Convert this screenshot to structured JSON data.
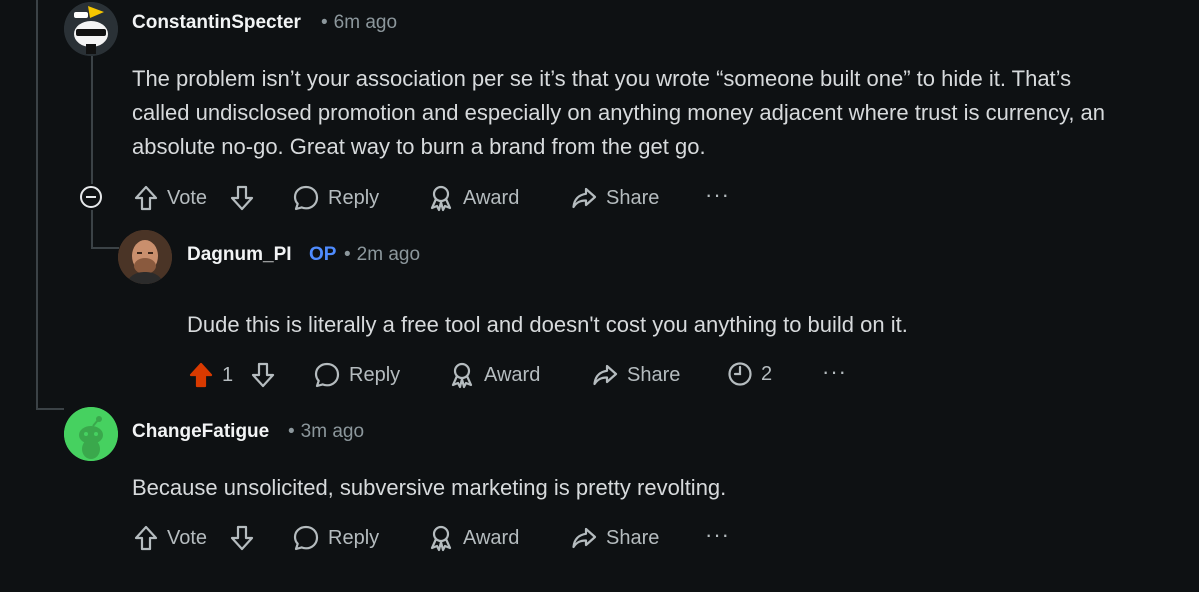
{
  "comments": [
    {
      "author": "ConstantinSpecter",
      "time": "6m ago",
      "text_lines": [
        "The problem isn’t your association per se it’s that you wrote “someone built one” to hide it. That’s",
        "called undisclosed promotion and especially on anything money adjacent where trust is currency, an",
        "absolute no-go. Great way to burn a brand from the get go."
      ],
      "actions": {
        "vote": "Vote",
        "reply": "Reply",
        "award": "Award",
        "share": "Share"
      }
    },
    {
      "author": "Dagnum_PI",
      "op_badge": "OP",
      "time": "2m ago",
      "text": "Dude this is literally a free tool and doesn't cost you anything to build on it.",
      "actions": {
        "votes": "1",
        "reply": "Reply",
        "award": "Award",
        "share": "Share",
        "awards_count": "2"
      },
      "upvoted_color": "#d93a00"
    },
    {
      "author": "ChangeFatigue",
      "time": "3m ago",
      "text": "Because unsolicited, subversive marketing is pretty revolting.",
      "actions": {
        "vote": "Vote",
        "reply": "Reply",
        "award": "Award",
        "share": "Share"
      }
    }
  ],
  "colors": {
    "background": "#0e1113",
    "op": "#4f8cff",
    "upvote": "#d93a00",
    "green_avatar": "#46d160"
  }
}
